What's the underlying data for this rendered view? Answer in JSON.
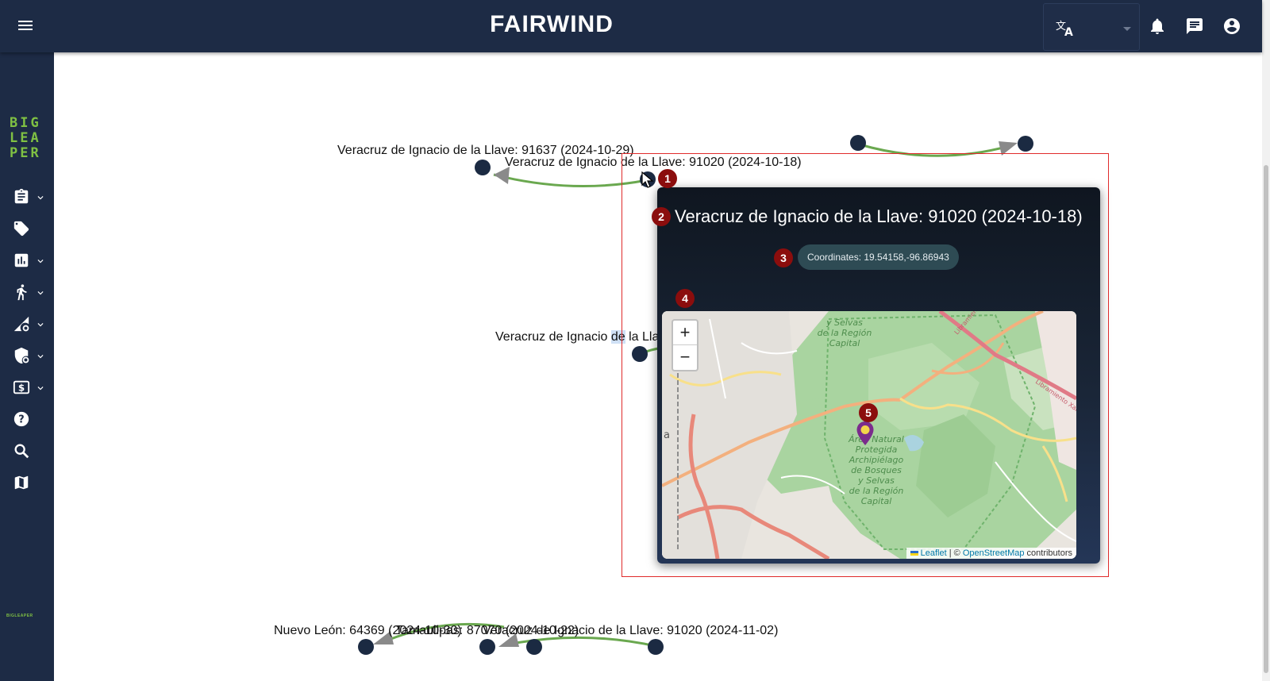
{
  "app": {
    "title": "FAIRWIND",
    "logo_text": "BIG\nLEA\nPER",
    "small_logo_text": "BIGLEAPER"
  },
  "topbar": {
    "menu_icon": "hamburger-menu-icon",
    "language_icon": "translate-icon",
    "notifications_icon": "bell-icon",
    "messages_icon": "chat-icon",
    "account_icon": "account-circle-icon"
  },
  "sidebar": {
    "items": [
      {
        "icon": "clipboard-icon",
        "has_chevron": true
      },
      {
        "icon": "tag-icon",
        "has_chevron": false
      },
      {
        "icon": "bar-chart-icon",
        "has_chevron": true
      },
      {
        "icon": "person-walking-icon",
        "has_chevron": true
      },
      {
        "icon": "signal-settings-icon",
        "has_chevron": true
      },
      {
        "icon": "shield-settings-icon",
        "has_chevron": true
      },
      {
        "icon": "dollar-icon",
        "has_chevron": true
      },
      {
        "icon": "help-icon",
        "has_chevron": false
      },
      {
        "icon": "search-icon",
        "has_chevron": false
      },
      {
        "icon": "map-icon",
        "has_chevron": false
      }
    ]
  },
  "graph": {
    "labels": [
      {
        "text": "Veracruz de Ignacio de la Llave: 91637 (2024-10-29)"
      },
      {
        "text": "Veracruz de Ignacio de la Llave: 91020 (2024-10-18)"
      },
      {
        "text_before": "Veracruz de Ignacio ",
        "text_highlight": "de",
        "text_after": " la Llav"
      },
      {
        "text": "Nuevo León: 64369 (2024-10-30)"
      },
      {
        "text": "Tamaulipas: 87070 (2024-10-22)"
      },
      {
        "text": "Veracruz de Ignacio de la Llave: 91020 (2024-11-02)"
      }
    ],
    "edge_color": "#6aa84f",
    "node_color": "#1b2a42"
  },
  "annotations": [
    "1",
    "2",
    "3",
    "4",
    "5"
  ],
  "popup": {
    "title": "Veracruz de Ignacio de la Llave: 91020 (2024-10-18)",
    "coordinates_text": "Coordinates: 19.54158,-96.86943",
    "map": {
      "zoom_in": "+",
      "zoom_out": "−",
      "attribution_leaflet": "Leaflet",
      "attribution_sep": " | © ",
      "attribution_osm": "OpenStreetMap",
      "attribution_suffix": " contributors",
      "labels": {
        "top_area": "y Selvas\nde la Región\nCapital",
        "center_area": "Área Natural\nProtegida\nArchipiélago\nde Bosques\ny Selvas\nde la Región\nCapital",
        "road1": "Libramiento Xalapa",
        "road2": "Libramiento Xalapa",
        "edge_letter": "a"
      },
      "marker_icon": "map-pin-icon"
    }
  }
}
